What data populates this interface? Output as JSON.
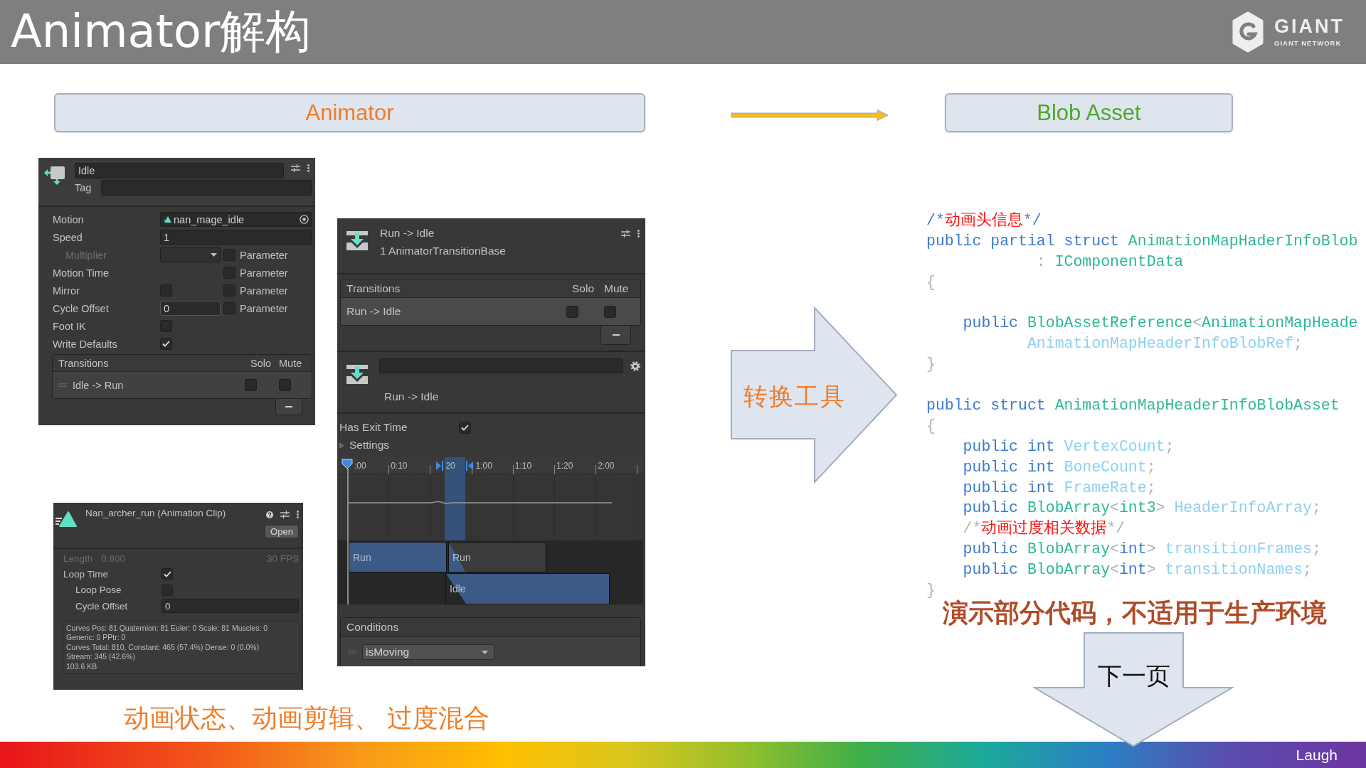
{
  "slide": {
    "title": "Animator解构",
    "logo": {
      "wordmark": "GIANT",
      "tagline": "GIANT NETWORK"
    }
  },
  "source_box": {
    "label": "Animator"
  },
  "target_box": {
    "label": "Blob Asset"
  },
  "state_inspector": {
    "name": "Idle",
    "tag_label": "Tag",
    "rows": [
      {
        "kind": "object",
        "label": "Motion",
        "value": "nan_mage_idle",
        "disabled": false
      },
      {
        "kind": "text",
        "label": "Speed",
        "value": "1",
        "disabled": false,
        "children": [
          {
            "kind": "dropdown",
            "label": "Multiplier",
            "disabled": true,
            "parameter": {
              "label": "Parameter",
              "checked": false
            }
          }
        ]
      },
      {
        "kind": "label",
        "label": "Motion Time",
        "disabled": false,
        "parameter": {
          "label": "Parameter",
          "checked": false
        }
      },
      {
        "kind": "checkbox",
        "label": "Mirror",
        "checked": false,
        "disabled": false,
        "parameter": {
          "label": "Parameter",
          "checked": false
        }
      },
      {
        "kind": "number",
        "label": "Cycle Offset",
        "value": "0",
        "disabled": false,
        "parameter": {
          "label": "Parameter",
          "checked": false
        }
      },
      {
        "kind": "checkbox",
        "label": "Foot IK",
        "checked": false,
        "disabled": false
      },
      {
        "kind": "checkbox",
        "label": "Write Defaults",
        "checked": true,
        "disabled": false
      }
    ],
    "transitions": {
      "columns": [
        "Transitions",
        "Solo",
        "Mute"
      ],
      "rows": [
        {
          "name": "Idle -> Run",
          "selected": false,
          "solo": false,
          "mute": false
        }
      ]
    }
  },
  "transition_inspector": {
    "title": "Run -> Idle",
    "subtitle": "1 AnimatorTransitionBase",
    "transitions": {
      "columns": [
        "Transitions",
        "Solo",
        "Mute"
      ],
      "rows": [
        {
          "name": "Run -> Idle",
          "selected": true,
          "solo": false,
          "mute": false
        }
      ]
    },
    "detail_title": "Run -> Idle",
    "has_exit_time": {
      "label": "Has Exit Time",
      "checked": true
    },
    "settings": {
      "label": "Settings",
      "expanded": false
    },
    "timeline": {
      "ruler": [
        ":00",
        "0:10",
        "20",
        "1:00",
        "1:10",
        "1:20",
        "2:00"
      ],
      "clips": [
        {
          "kind": "source",
          "label": "Run"
        },
        {
          "kind": "source_rest",
          "label": "Run"
        },
        {
          "kind": "destination",
          "label": "Idle"
        }
      ]
    },
    "conditions": {
      "title": "Conditions",
      "items": [
        {
          "parameter": "isMoving"
        }
      ]
    }
  },
  "clip_inspector": {
    "title": "Nan_archer_run (Animation Clip)",
    "open_button": "Open",
    "length_label": "Length",
    "length_value": "0.800",
    "fps": "30 FPS",
    "rows": [
      {
        "kind": "checkbox",
        "label": "Loop Time",
        "checked": true,
        "children": [
          {
            "kind": "checkbox",
            "label": "Loop Pose",
            "checked": false
          },
          {
            "kind": "number",
            "label": "Cycle Offset",
            "value": "0"
          }
        ]
      }
    ],
    "info_lines": [
      "Curves Pos: 81 Quaternion: 81 Euler: 0 Scale: 81 Muscles: 0",
      "Generic: 0 PPtr: 0",
      "Curves Total: 810, Constant: 465 (57.4%) Dense: 0 (0.0%)",
      "Stream: 345 (42.6%)",
      "103.6 KB"
    ]
  },
  "caption": "动画状态、动画剪辑、 过度混合",
  "convert_arrow": {
    "label": "转换工具"
  },
  "code": {
    "blocks": [
      {
        "lines": [
          {
            "tokens": [
              {
                "text": "/*",
                "kind": "delim"
              },
              {
                "text": "动画头信息",
                "kind": "comment"
              },
              {
                "text": "*/",
                "kind": "delim"
              }
            ]
          },
          {
            "tokens": [
              {
                "text": "public partial struct ",
                "kind": "keyword"
              },
              {
                "text": "AnimationMapHaderInfoBlob",
                "kind": "type"
              }
            ]
          },
          {
            "tokens": [
              {
                "text": "            : ",
                "kind": "punct"
              },
              {
                "text": "IComponentData",
                "kind": "type"
              }
            ]
          },
          {
            "tokens": [
              {
                "text": "{",
                "kind": "punct"
              }
            ]
          }
        ]
      },
      {
        "lines": [
          {
            "tokens": [
              {
                "text": "    public ",
                "kind": "keyword"
              },
              {
                "text": "BlobAssetReference",
                "kind": "type"
              },
              {
                "text": "<",
                "kind": "punct"
              },
              {
                "text": "AnimationMapHeade",
                "kind": "type"
              }
            ]
          },
          {
            "tokens": [
              {
                "text": "           AnimationMapHeaderInfoBlobRef",
                "kind": "field"
              },
              {
                "text": ";",
                "kind": "punct"
              }
            ]
          },
          {
            "tokens": [
              {
                "text": "}",
                "kind": "punct"
              }
            ]
          }
        ]
      },
      {
        "lines": [
          {
            "tokens": [
              {
                "text": "public struct ",
                "kind": "keyword"
              },
              {
                "text": "AnimationMapHeaderInfoBlobAsset",
                "kind": "type"
              }
            ]
          },
          {
            "tokens": [
              {
                "text": "{",
                "kind": "punct"
              }
            ]
          },
          {
            "tokens": [
              {
                "text": "    public int ",
                "kind": "keyword"
              },
              {
                "text": "VertexCount",
                "kind": "field"
              },
              {
                "text": ";",
                "kind": "punct"
              }
            ]
          },
          {
            "tokens": [
              {
                "text": "    public int ",
                "kind": "keyword"
              },
              {
                "text": "BoneCount",
                "kind": "field"
              },
              {
                "text": ";",
                "kind": "punct"
              }
            ]
          },
          {
            "tokens": [
              {
                "text": "    public int ",
                "kind": "keyword"
              },
              {
                "text": "FrameRate",
                "kind": "field"
              },
              {
                "text": ";",
                "kind": "punct"
              }
            ]
          },
          {
            "tokens": [
              {
                "text": "    public ",
                "kind": "keyword"
              },
              {
                "text": "BlobArray",
                "kind": "type"
              },
              {
                "text": "<",
                "kind": "punct"
              },
              {
                "text": "int3",
                "kind": "type"
              },
              {
                "text": "> ",
                "kind": "punct"
              },
              {
                "text": "HeaderInfoArray",
                "kind": "field"
              },
              {
                "text": ";",
                "kind": "punct"
              }
            ]
          },
          {
            "tokens": [
              {
                "text": "    /*",
                "kind": "punct"
              },
              {
                "text": "动画过度相关数据",
                "kind": "comment"
              },
              {
                "text": "*/",
                "kind": "punct"
              }
            ]
          },
          {
            "tokens": [
              {
                "text": "    public ",
                "kind": "keyword"
              },
              {
                "text": "BlobArray",
                "kind": "type"
              },
              {
                "text": "<",
                "kind": "punct"
              },
              {
                "text": "int",
                "kind": "keyword"
              },
              {
                "text": "> ",
                "kind": "punct"
              },
              {
                "text": "transitionFrames",
                "kind": "field"
              },
              {
                "text": ";",
                "kind": "punct"
              }
            ]
          },
          {
            "tokens": [
              {
                "text": "    public ",
                "kind": "keyword"
              },
              {
                "text": "BlobArray",
                "kind": "type"
              },
              {
                "text": "<",
                "kind": "punct"
              },
              {
                "text": "int",
                "kind": "keyword"
              },
              {
                "text": "> ",
                "kind": "punct"
              },
              {
                "text": "transitionNames",
                "kind": "field"
              },
              {
                "text": ";",
                "kind": "punct"
              }
            ]
          },
          {
            "tokens": [
              {
                "text": "}",
                "kind": "punct"
              }
            ]
          }
        ]
      }
    ]
  },
  "note": "演示部分代码，不适用于生产环境",
  "next_arrow": {
    "label": "下一页"
  },
  "footer": {
    "label": "Laugh"
  }
}
